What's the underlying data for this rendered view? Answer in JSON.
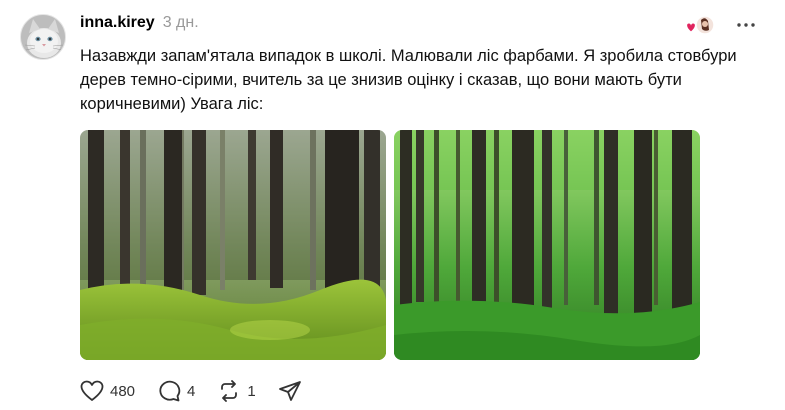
{
  "post": {
    "username": "inna.kirey",
    "time_ago": "3 дн.",
    "text": "Назавжди запам'ятала випадок в школі. Малювали ліс фарбами. Я зробила стовбури дерев темно-сірими, вчитель за це знизив оцінку і сказав, що вони мають бути коричневими) Увага ліс:",
    "images": [
      {
        "name": "forest-photo-1",
        "description_icon": "image"
      },
      {
        "name": "forest-photo-2",
        "description_icon": "image"
      }
    ]
  },
  "actions": {
    "likes": "480",
    "comments": "4",
    "reposts": "1",
    "icons": [
      "heart-icon",
      "comment-icon",
      "repost-icon",
      "share-icon"
    ]
  },
  "colors": {
    "username": "#000000",
    "time": "#999999",
    "like_heart": "#e0245e"
  }
}
